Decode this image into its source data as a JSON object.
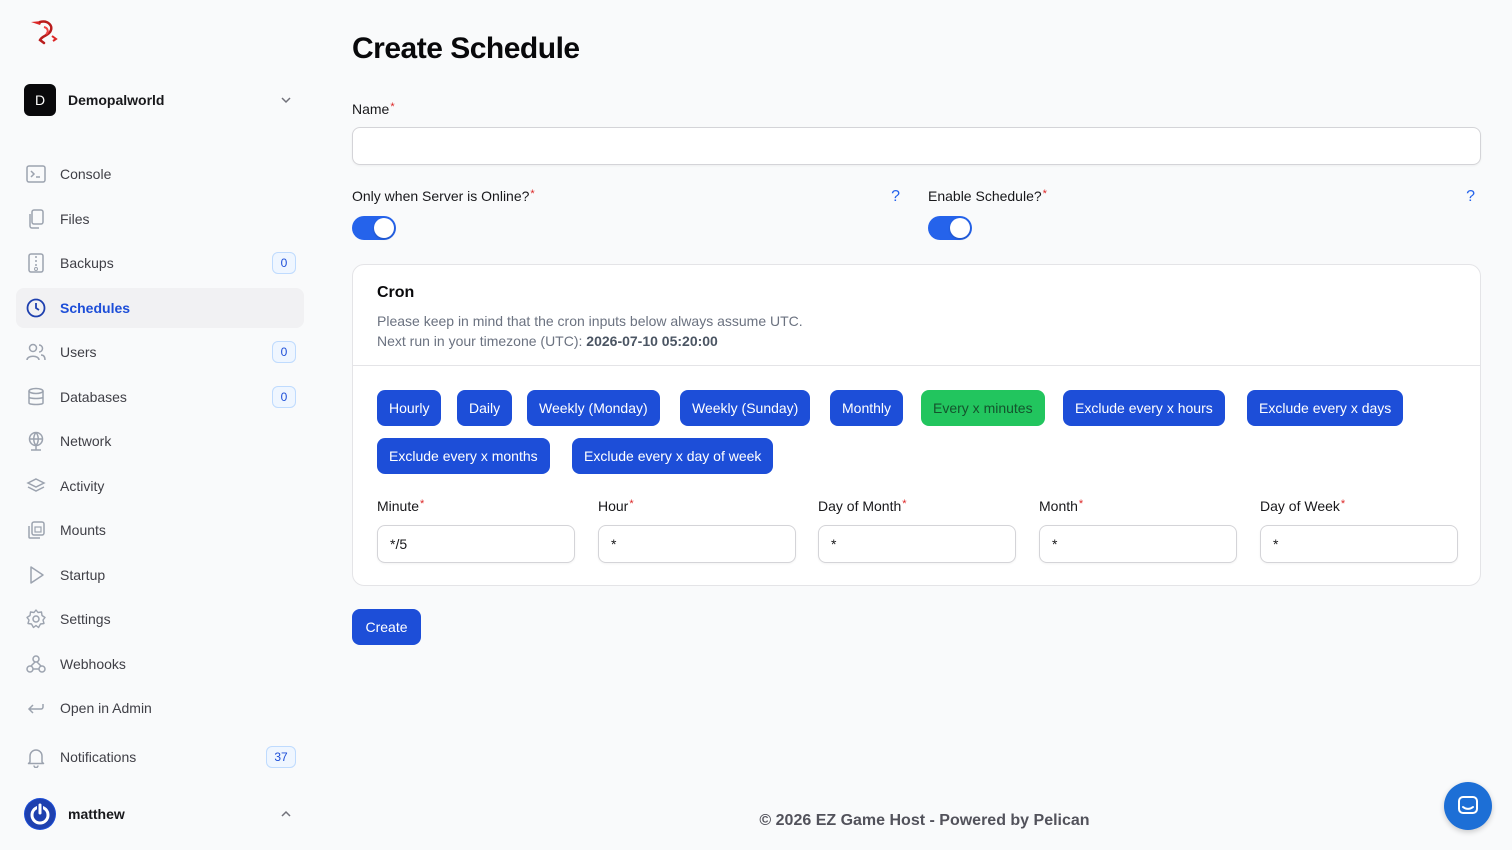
{
  "brand": {
    "accent": "#1d4ed8",
    "logo_icon": "dragon-logo-icon"
  },
  "server": {
    "avatar_letter": "D",
    "name": "Demopalworld"
  },
  "sidebar": {
    "items": [
      {
        "label": "Console",
        "icon": "terminal-icon",
        "badge": ""
      },
      {
        "label": "Files",
        "icon": "files-icon",
        "badge": ""
      },
      {
        "label": "Backups",
        "icon": "archive-icon",
        "badge": "0"
      },
      {
        "label": "Schedules",
        "icon": "clock-icon",
        "badge": "",
        "active": true
      },
      {
        "label": "Users",
        "icon": "users-icon",
        "badge": "0"
      },
      {
        "label": "Databases",
        "icon": "database-icon",
        "badge": "0"
      },
      {
        "label": "Network",
        "icon": "globe-icon",
        "badge": ""
      },
      {
        "label": "Activity",
        "icon": "layers-icon",
        "badge": ""
      },
      {
        "label": "Mounts",
        "icon": "mounts-icon",
        "badge": ""
      },
      {
        "label": "Startup",
        "icon": "play-icon",
        "badge": ""
      },
      {
        "label": "Settings",
        "icon": "gear-icon",
        "badge": ""
      },
      {
        "label": "Webhooks",
        "icon": "webhook-icon",
        "badge": ""
      },
      {
        "label": "Open in Admin",
        "icon": "return-arrow-icon",
        "badge": ""
      }
    ],
    "notifications": {
      "label": "Notifications",
      "badge": "37"
    },
    "user": {
      "name": "matthew"
    }
  },
  "page": {
    "title": "Create Schedule",
    "name_label": "Name",
    "name_value": "",
    "only_online_label": "Only when Server is Online?",
    "only_online_on": true,
    "enable_label": "Enable Schedule?",
    "enable_on": true,
    "help_symbol": "?",
    "required_mark": "*",
    "cron": {
      "title": "Cron",
      "desc_line1": "Please keep in mind that the cron inputs below always assume UTC.",
      "desc_line2_prefix": "Next run in your timezone (UTC): ",
      "next_run": "2026-07-10 05:20:00",
      "presets": [
        "Hourly",
        "Daily",
        "Weekly (Monday)",
        "Weekly (Sunday)",
        "Monthly",
        "Every x minutes",
        "Exclude every x hours",
        "Exclude every x days",
        "Exclude every x months",
        "Exclude every x day of week"
      ],
      "fields": [
        {
          "label": "Minute",
          "value": "*/5"
        },
        {
          "label": "Hour",
          "value": "*"
        },
        {
          "label": "Day of Month",
          "value": "*"
        },
        {
          "label": "Month",
          "value": "*"
        },
        {
          "label": "Day of Week",
          "value": "*"
        }
      ]
    },
    "create_label": "Create"
  },
  "footer": {
    "text": "© 2026 EZ Game Host - Powered by Pelican"
  }
}
